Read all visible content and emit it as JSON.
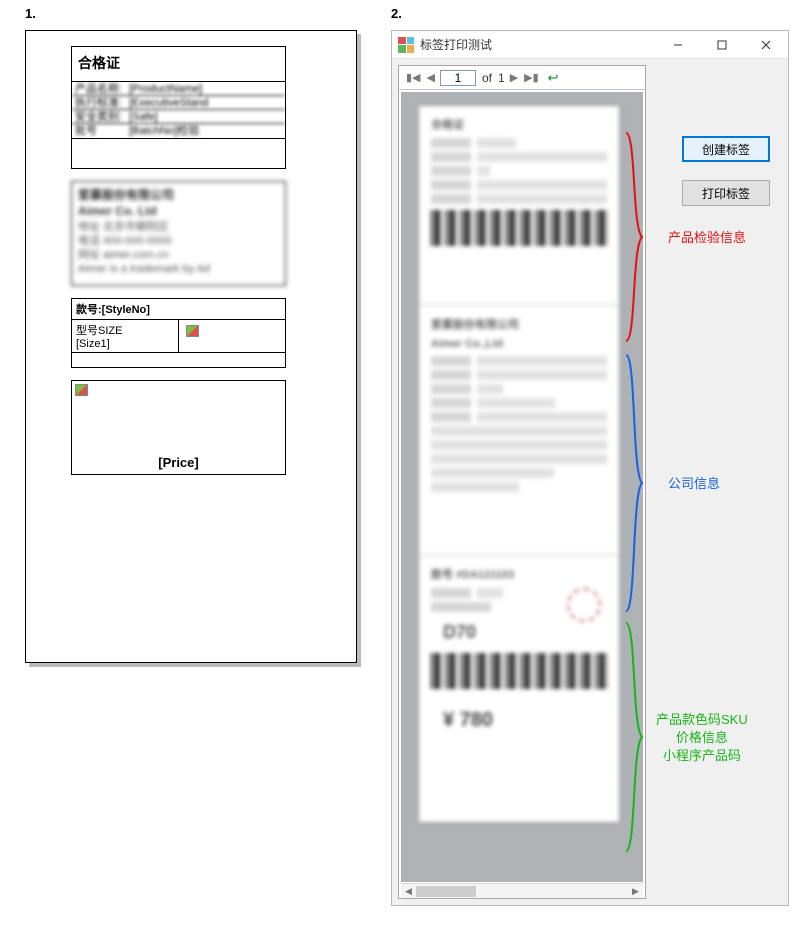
{
  "labels": {
    "one": "1.",
    "two": "2."
  },
  "template": {
    "cert_title": "合格证",
    "rows": [
      {
        "lab": "产品名称:",
        "val": "[ProductName]"
      },
      {
        "lab": "执行标准:",
        "val": "[ExecutiveStand"
      },
      {
        "lab": "安全类别:",
        "val": "[Safe]"
      },
      {
        "lab": "批号",
        "val": "[BatchNo]检验"
      }
    ],
    "company_title": "Aimer Co. Ltd",
    "style_label": "款号:[StyleNo]",
    "size_label": "型号SIZE",
    "size_value": "[Size1]",
    "price_label": "[Price]"
  },
  "window": {
    "title": "标签打印测试",
    "pager": {
      "current": "1",
      "of_label": "of",
      "total": "1"
    },
    "buttons": {
      "create": "创建标签",
      "print": "打印标签"
    },
    "annotations": {
      "inspect": "产品检验信息",
      "company": "公司信息",
      "sku_line1": "产品款色码SKU",
      "sku_line2": "价格信息",
      "sku_line3": "小程序产品码"
    },
    "preview": {
      "d70": "D70",
      "price": "¥ 780"
    }
  }
}
